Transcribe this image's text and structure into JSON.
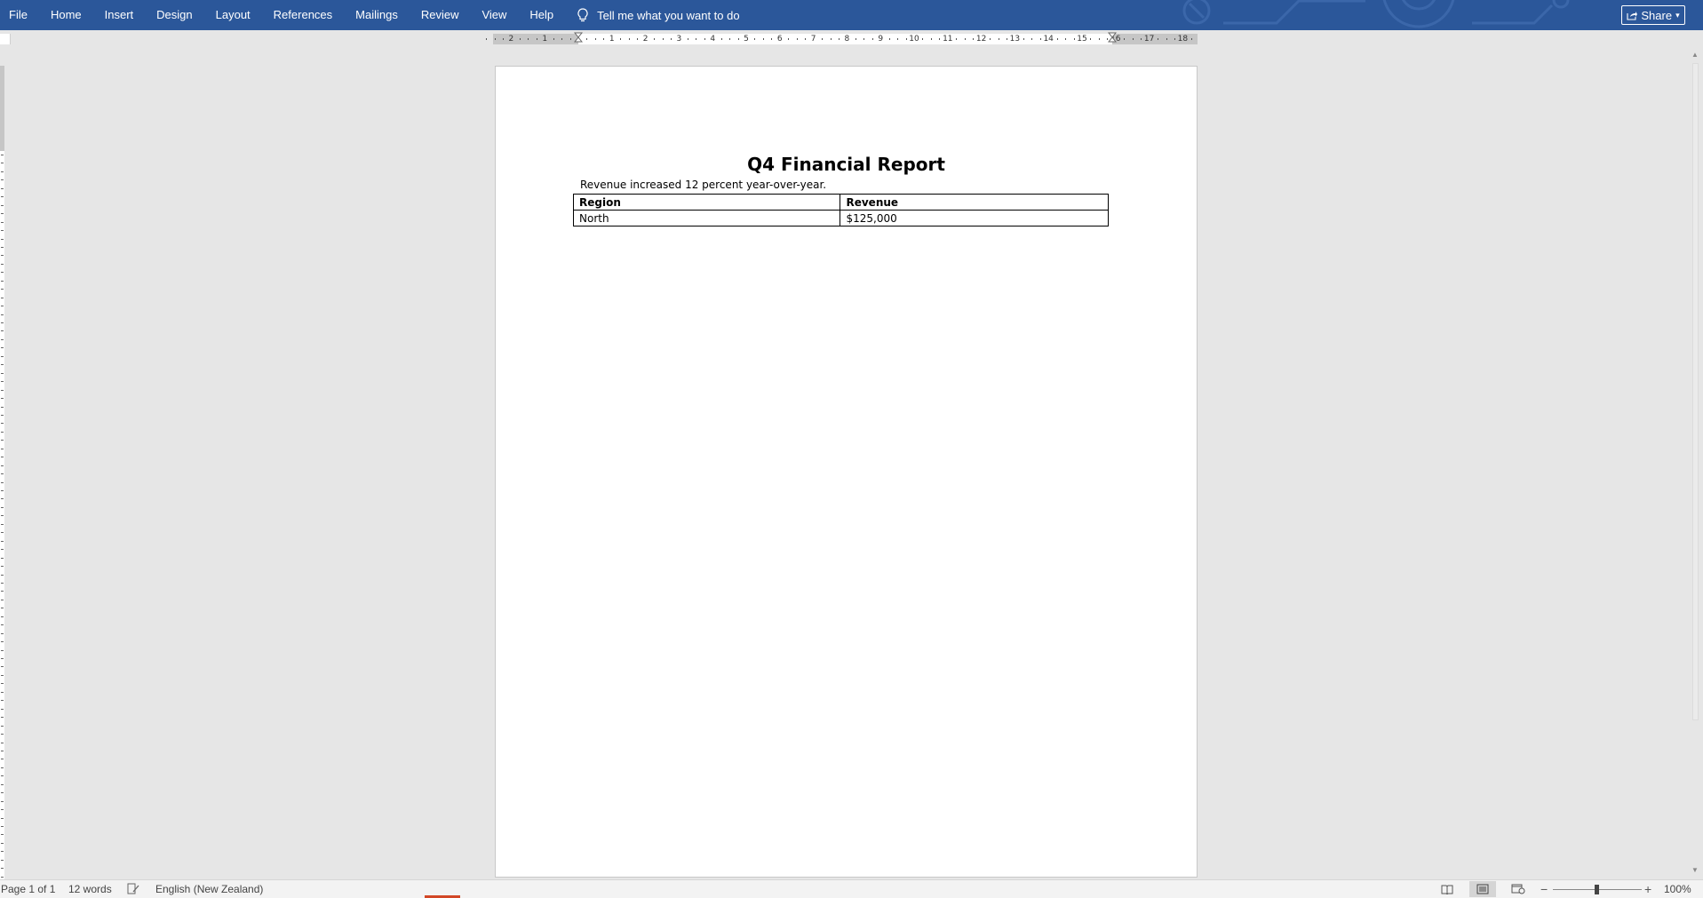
{
  "menubar": {
    "items": [
      "File",
      "Home",
      "Insert",
      "Design",
      "Layout",
      "References",
      "Mailings",
      "Review",
      "View",
      "Help"
    ],
    "tell_me": "Tell me what you want to do",
    "share_label": "Share"
  },
  "ruler": {
    "left_labels": [
      "2",
      "1"
    ],
    "right_labels": [
      "1",
      "2",
      "3",
      "4",
      "5",
      "6",
      "7",
      "8",
      "9",
      "10",
      "11",
      "12",
      "13",
      "14",
      "15",
      "16",
      "17",
      "18"
    ]
  },
  "document": {
    "title": "Q4 Financial Report",
    "paragraph": "Revenue increased 12 percent year-over-year.",
    "table": {
      "headers": [
        "Region",
        "Revenue"
      ],
      "rows": [
        [
          "North",
          "$125,000"
        ]
      ]
    }
  },
  "statusbar": {
    "page": "Page 1 of 1",
    "words": "12 words",
    "language": "English (New Zealand)",
    "zoom": "100%"
  },
  "colors": {
    "ribbon": "#2b579a",
    "accent_red": "#d24726"
  }
}
